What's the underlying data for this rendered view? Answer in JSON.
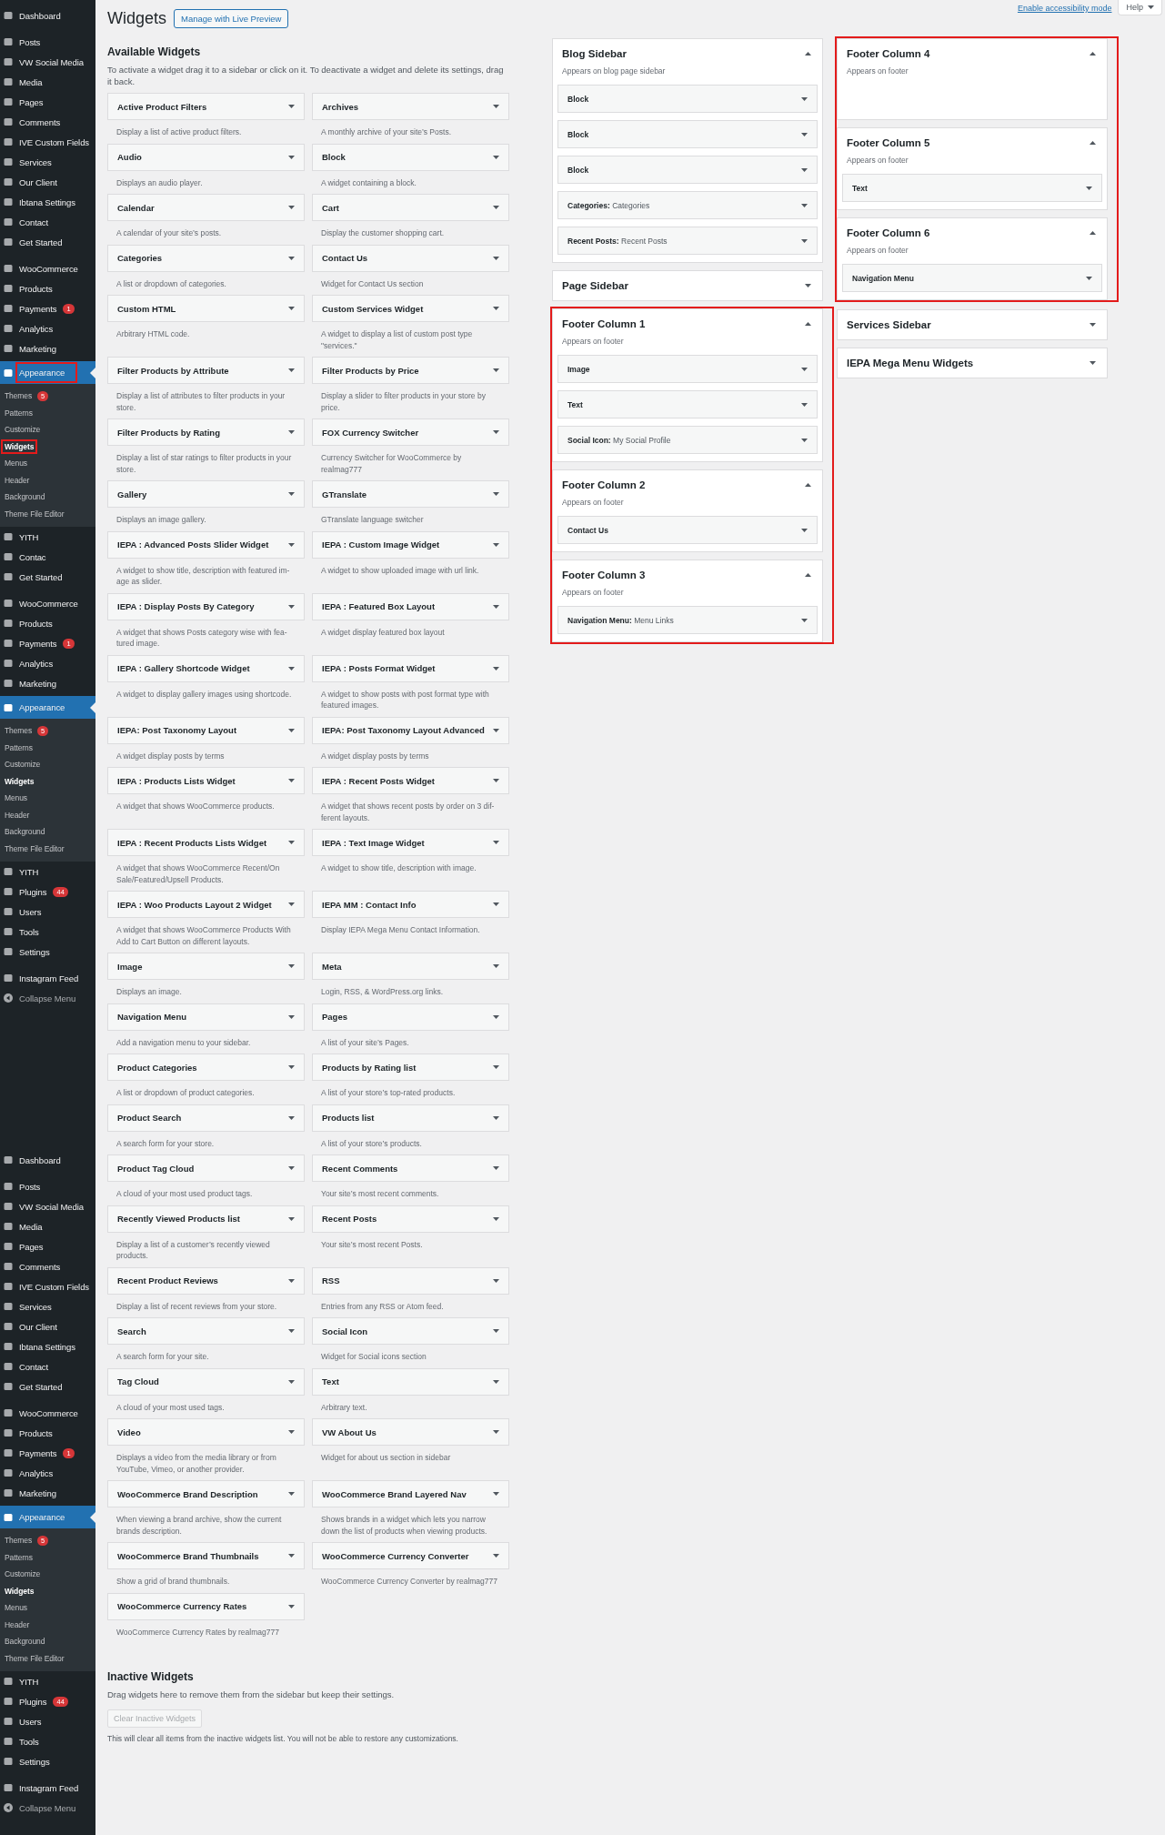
{
  "admin_menu": {
    "segments": [
      {
        "entries": [
          {
            "kind": "item",
            "label": "Dashboard",
            "outlined": false
          },
          {
            "kind": "separator"
          },
          {
            "kind": "item",
            "label": "Posts",
            "outlined": false
          },
          {
            "kind": "item",
            "label": "VW Social Media",
            "outlined": false
          },
          {
            "kind": "item",
            "label": "Media",
            "outlined": false
          },
          {
            "kind": "item",
            "label": "Pages",
            "outlined": false
          },
          {
            "kind": "item",
            "label": "Comments",
            "outlined": false
          },
          {
            "kind": "item",
            "label": "IVE Custom Fields",
            "outlined": false
          },
          {
            "kind": "item",
            "label": "Services",
            "outlined": false
          },
          {
            "kind": "item",
            "label": "Our Client",
            "outlined": false
          },
          {
            "kind": "item",
            "label": "Ibtana Settings",
            "outlined": false
          },
          {
            "kind": "item",
            "label": "Contact",
            "outlined": false
          },
          {
            "kind": "item",
            "label": "Get Started",
            "outlined": false
          },
          {
            "kind": "separator"
          },
          {
            "kind": "item",
            "label": "WooCommerce",
            "outlined": false
          },
          {
            "kind": "item",
            "label": "Products",
            "outlined": false
          },
          {
            "kind": "item",
            "label": "Payments",
            "badge": "1",
            "outlined": false
          },
          {
            "kind": "item",
            "label": "Analytics",
            "outlined": false
          },
          {
            "kind": "item",
            "label": "Marketing",
            "outlined": false
          },
          {
            "kind": "current",
            "label": "Appearance",
            "outlined": true
          },
          {
            "kind": "sub",
            "label": "Themes",
            "badge": "5",
            "outlined": false
          },
          {
            "kind": "sub",
            "label": "Patterns",
            "outlined": false
          },
          {
            "kind": "sub",
            "label": "Customize",
            "outlined": false
          },
          {
            "kind": "sub_current",
            "label": "Widgets",
            "outlined": true
          },
          {
            "kind": "sub",
            "label": "Menus",
            "outlined": false
          },
          {
            "kind": "sub",
            "label": "Header",
            "outlined": false
          },
          {
            "kind": "sub",
            "label": "Background",
            "outlined": false
          },
          {
            "kind": "sub",
            "label": "Theme File Editor",
            "outlined": false
          },
          {
            "kind": "item",
            "label": "YITH",
            "outlined": false
          },
          {
            "kind": "item",
            "label": "Contac",
            "outlined": false
          },
          {
            "kind": "item",
            "label": "Get Started",
            "outlined": false
          },
          {
            "kind": "separator"
          },
          {
            "kind": "item",
            "label": "WooCommerce",
            "outlined": false
          },
          {
            "kind": "item",
            "label": "Products",
            "outlined": false
          },
          {
            "kind": "item",
            "label": "Payments",
            "badge": "1",
            "outlined": false
          },
          {
            "kind": "item",
            "label": "Analytics",
            "outlined": false
          },
          {
            "kind": "item",
            "label": "Marketing",
            "outlined": false
          },
          {
            "kind": "current",
            "label": "Appearance",
            "outlined": false
          },
          {
            "kind": "sub",
            "label": "Themes",
            "badge": "5",
            "outlined": false
          },
          {
            "kind": "sub",
            "label": "Patterns",
            "outlined": false
          },
          {
            "kind": "sub",
            "label": "Customize",
            "outlined": false
          },
          {
            "kind": "sub_current",
            "label": "Widgets",
            "outlined": false
          },
          {
            "kind": "sub",
            "label": "Menus",
            "outlined": false
          },
          {
            "kind": "sub",
            "label": "Header",
            "outlined": false
          },
          {
            "kind": "sub",
            "label": "Background",
            "outlined": false
          },
          {
            "kind": "sub",
            "label": "Theme File Editor",
            "outlined": false
          },
          {
            "kind": "item",
            "label": "YITH",
            "outlined": false
          },
          {
            "kind": "item",
            "label": "Plugins",
            "badge": "44",
            "outlined": false
          },
          {
            "kind": "item",
            "label": "Users",
            "outlined": false
          },
          {
            "kind": "item",
            "label": "Tools",
            "outlined": false
          },
          {
            "kind": "item",
            "label": "Settings",
            "outlined": false
          },
          {
            "kind": "separator"
          },
          {
            "kind": "item",
            "label": "Instagram Feed",
            "outlined": false
          },
          {
            "kind": "collapse",
            "label": "Collapse Menu",
            "outlined": false
          }
        ]
      },
      {
        "entries": [
          {
            "kind": "item",
            "label": "Dashboard",
            "outlined": false
          },
          {
            "kind": "separator"
          },
          {
            "kind": "item",
            "label": "Posts",
            "outlined": false
          },
          {
            "kind": "item",
            "label": "VW Social Media",
            "outlined": false
          },
          {
            "kind": "item",
            "label": "Media",
            "outlined": false
          },
          {
            "kind": "item",
            "label": "Pages",
            "outlined": false
          },
          {
            "kind": "item",
            "label": "Comments",
            "outlined": false
          },
          {
            "kind": "item",
            "label": "IVE Custom Fields",
            "outlined": false
          },
          {
            "kind": "item",
            "label": "Services",
            "outlined": false
          },
          {
            "kind": "item",
            "label": "Our Client",
            "outlined": false
          },
          {
            "kind": "item",
            "label": "Ibtana Settings",
            "outlined": false
          },
          {
            "kind": "item",
            "label": "Contact",
            "outlined": false
          },
          {
            "kind": "item",
            "label": "Get Started",
            "outlined": false
          },
          {
            "kind": "separator"
          },
          {
            "kind": "item",
            "label": "WooCommerce",
            "outlined": false
          },
          {
            "kind": "item",
            "label": "Products",
            "outlined": false
          },
          {
            "kind": "item",
            "label": "Payments",
            "badge": "1",
            "outlined": false
          },
          {
            "kind": "item",
            "label": "Analytics",
            "outlined": false
          },
          {
            "kind": "item",
            "label": "Marketing",
            "outlined": false
          },
          {
            "kind": "current",
            "label": "Appearance",
            "outlined": false
          },
          {
            "kind": "sub",
            "label": "Themes",
            "badge": "5",
            "outlined": false
          },
          {
            "kind": "sub",
            "label": "Patterns",
            "outlined": false
          },
          {
            "kind": "sub",
            "label": "Customize",
            "outlined": false
          },
          {
            "kind": "sub_current",
            "label": "Widgets",
            "outlined": false
          },
          {
            "kind": "sub",
            "label": "Menus",
            "outlined": false
          },
          {
            "kind": "sub",
            "label": "Header",
            "outlined": false
          },
          {
            "kind": "sub",
            "label": "Background",
            "outlined": false
          },
          {
            "kind": "sub",
            "label": "Theme File Editor",
            "outlined": false
          },
          {
            "kind": "item",
            "label": "YITH",
            "outlined": false
          },
          {
            "kind": "item",
            "label": "Plugins",
            "badge": "44",
            "outlined": false
          },
          {
            "kind": "item",
            "label": "Users",
            "outlined": false
          },
          {
            "kind": "item",
            "label": "Tools",
            "outlined": false
          },
          {
            "kind": "item",
            "label": "Settings",
            "outlined": false
          },
          {
            "kind": "separator"
          },
          {
            "kind": "item",
            "label": "Instagram Feed",
            "outlined": false
          },
          {
            "kind": "collapse",
            "label": "Collapse Menu",
            "outlined": false
          }
        ]
      }
    ]
  },
  "screen_meta": {
    "accessibility_link": "Enable accessibility mode",
    "help_button": "Help"
  },
  "page_title": "Widgets",
  "live_preview_button": "Manage with Live Preview",
  "available_widgets": {
    "heading": "Available Widgets",
    "description": "To activate a widget drag it to a sidebar or click on it. To deactivate a widget and delete its settings, drag it back.",
    "widgets": [
      {
        "name": "Active Product Filters",
        "description": "Display a list of active product filters."
      },
      {
        "name": "Archives",
        "description": "A monthly archive of your site’s Posts."
      },
      {
        "name": "Audio",
        "description": "Displays an audio player."
      },
      {
        "name": "Block",
        "description": "A widget containing a block."
      },
      {
        "name": "Calendar",
        "description": "A calendar of your site’s posts."
      },
      {
        "name": "Cart",
        "description": "Display the customer shopping cart."
      },
      {
        "name": "Categories",
        "description": "A list or dropdown of categories."
      },
      {
        "name": "Contact Us",
        "description": "Widget for Contact Us section"
      },
      {
        "name": "Custom HTML",
        "description": "Arbitrary HTML code."
      },
      {
        "name": "Custom Services Widget",
        "description": "A widget to display a list of custom post type \"services.\""
      },
      {
        "name": "Filter Products by Attribute",
        "description": "Display a list of attributes to filter products in your store."
      },
      {
        "name": "Filter Products by Price",
        "description": "Display a slider to filter products in your store by price."
      },
      {
        "name": "Filter Products by Rating",
        "description": "Display a list of star ratings to filter products in your store."
      },
      {
        "name": "FOX Currency Switcher",
        "description": "Currency Switcher for WooCommerce by realmag777"
      },
      {
        "name": "Gallery",
        "description": "Displays an image gallery."
      },
      {
        "name": "GTranslate",
        "description": "GTranslate language switcher"
      },
      {
        "name": "IEPA : Advanced Posts Slider Widget",
        "description": "A widget to show title, description with featured im-age as slider."
      },
      {
        "name": "IEPA : Custom Image Widget",
        "description": "A widget to show uploaded image with url link."
      },
      {
        "name": "IEPA : Display Posts By Category",
        "description": "A widget that shows Posts category wise with fea-tured image."
      },
      {
        "name": "IEPA : Featured Box Layout",
        "description": "A widget display featured box layout"
      },
      {
        "name": "IEPA : Gallery Shortcode Widget",
        "description": "A widget to display gallery images using shortcode."
      },
      {
        "name": "IEPA : Posts Format Widget",
        "description": "A widget to show posts with post format type with featured images."
      },
      {
        "name": "IEPA: Post Taxonomy Layout",
        "description": "A widget display posts by terms"
      },
      {
        "name": "IEPA: Post Taxonomy Layout Advanced",
        "description": "A widget display posts by terms"
      },
      {
        "name": "IEPA : Products Lists Widget",
        "description": "A widget that shows WooCommerce products."
      },
      {
        "name": "IEPA : Recent Posts Widget",
        "description": "A widget that shows recent posts by order on 3 dif-ferent layouts."
      },
      {
        "name": "IEPA : Recent Products Lists Widget",
        "description": "A widget that shows WooCommerce Recent/On Sale/Featured/Upsell Products."
      },
      {
        "name": "IEPA : Text Image Widget",
        "description": "A widget to show title, description with image."
      },
      {
        "name": "IEPA : Woo Products Layout 2 Widget",
        "description": "A widget that shows WooCommerce Products With Add to Cart Button on different layouts."
      },
      {
        "name": "IEPA MM : Contact Info",
        "description": "Display IEPA Mega Menu Contact Information."
      },
      {
        "name": "Image",
        "description": "Displays an image."
      },
      {
        "name": "Meta",
        "description": "Login, RSS, & WordPress.org links."
      },
      {
        "name": "Navigation Menu",
        "description": "Add a navigation menu to your sidebar."
      },
      {
        "name": "Pages",
        "description": "A list of your site’s Pages."
      },
      {
        "name": "Product Categories",
        "description": "A list or dropdown of product categories."
      },
      {
        "name": "Products by Rating list",
        "description": "A list of your store’s top-rated products."
      },
      {
        "name": "Product Search",
        "description": "A search form for your store."
      },
      {
        "name": "Products list",
        "description": "A list of your store’s products."
      },
      {
        "name": "Product Tag Cloud",
        "description": "A cloud of your most used product tags."
      },
      {
        "name": "Recent Comments",
        "description": "Your site’s most recent comments."
      },
      {
        "name": "Recently Viewed Products list",
        "description": "Display a list of a customer’s recently viewed products."
      },
      {
        "name": "Recent Posts",
        "description": "Your site’s most recent Posts."
      },
      {
        "name": "Recent Product Reviews",
        "description": "Display a list of recent reviews from your store."
      },
      {
        "name": "RSS",
        "description": "Entries from any RSS or Atom feed."
      },
      {
        "name": "Search",
        "description": "A search form for your site."
      },
      {
        "name": "Social Icon",
        "description": "Widget for Social icons section"
      },
      {
        "name": "Tag Cloud",
        "description": "A cloud of your most used tags."
      },
      {
        "name": "Text",
        "description": "Arbitrary text."
      },
      {
        "name": "Video",
        "description": "Displays a video from the media library or from YouTube, Vimeo, or another provider."
      },
      {
        "name": "VW About Us",
        "description": "Widget for about us section in sidebar"
      },
      {
        "name": "WooCommerce Brand Description",
        "description": "When viewing a brand archive, show the current brands description."
      },
      {
        "name": "WooCommerce Brand Layered Nav",
        "description": "Shows brands in a widget which lets you narrow down the list of products when viewing products."
      },
      {
        "name": "WooCommerce Brand Thumbnails",
        "description": "Show a grid of brand thumbnails."
      },
      {
        "name": "WooCommerce Currency Converter",
        "description": "WooCommerce Currency Converter by realmag777"
      },
      {
        "name": "WooCommerce Currency Rates",
        "description": "WooCommerce Currency Rates by realmag777"
      }
    ]
  },
  "inactive_widgets": {
    "heading": "Inactive Widgets",
    "description": "Drag widgets here to remove them from the sidebar but keep their settings.",
    "clear_button": "Clear Inactive Widgets",
    "clear_disabled": true,
    "note": "This will clear all items from the inactive widgets list. You will not be able to restore any customizations."
  },
  "sidebar_columns": [
    {
      "areas": [
        {
          "title": "Blog Sidebar",
          "description": "Appears on blog page sidebar",
          "expanded": true,
          "outlined": false,
          "widgets": [
            {
              "name": "Block"
            },
            {
              "name": "Block"
            },
            {
              "name": "Block"
            },
            {
              "name": "Categories:",
              "title": "Categories"
            },
            {
              "name": "Recent Posts:",
              "title": "Recent Posts"
            }
          ]
        },
        {
          "title": "Page Sidebar",
          "expanded": false,
          "outlined": false
        },
        {
          "title": "Footer Column 1",
          "description": "Appears on footer",
          "expanded": true,
          "outlined": true,
          "widgets": [
            {
              "name": "Image"
            },
            {
              "name": "Text"
            },
            {
              "name": "Social Icon:",
              "title": "My Social Profile"
            }
          ]
        },
        {
          "title": "Footer Column 2",
          "description": "Appears on footer",
          "expanded": true,
          "outlined": true,
          "widgets": [
            {
              "name": "Contact Us"
            }
          ]
        },
        {
          "title": "Footer Column 3",
          "description": "Appears on footer",
          "expanded": true,
          "outlined": true,
          "widgets": [
            {
              "name": "Navigation Menu:",
              "title": "Menu Links"
            }
          ]
        }
      ]
    },
    {
      "areas": [
        {
          "title": "Footer Column 4",
          "description": "Appears on footer",
          "expanded": true,
          "outlined": true
        },
        {
          "title": "Footer Column 5",
          "description": "Appears on footer",
          "expanded": true,
          "outlined": true,
          "widgets": [
            {
              "name": "Text"
            }
          ]
        },
        {
          "title": "Footer Column 6",
          "description": "Appears on footer",
          "expanded": true,
          "outlined": true,
          "widgets": [
            {
              "name": "Navigation Menu"
            }
          ]
        },
        {
          "title": "Services Sidebar",
          "expanded": false,
          "outlined": false
        },
        {
          "title": "IEPA Mega Menu Widgets",
          "expanded": false,
          "outlined": false
        }
      ]
    }
  ]
}
